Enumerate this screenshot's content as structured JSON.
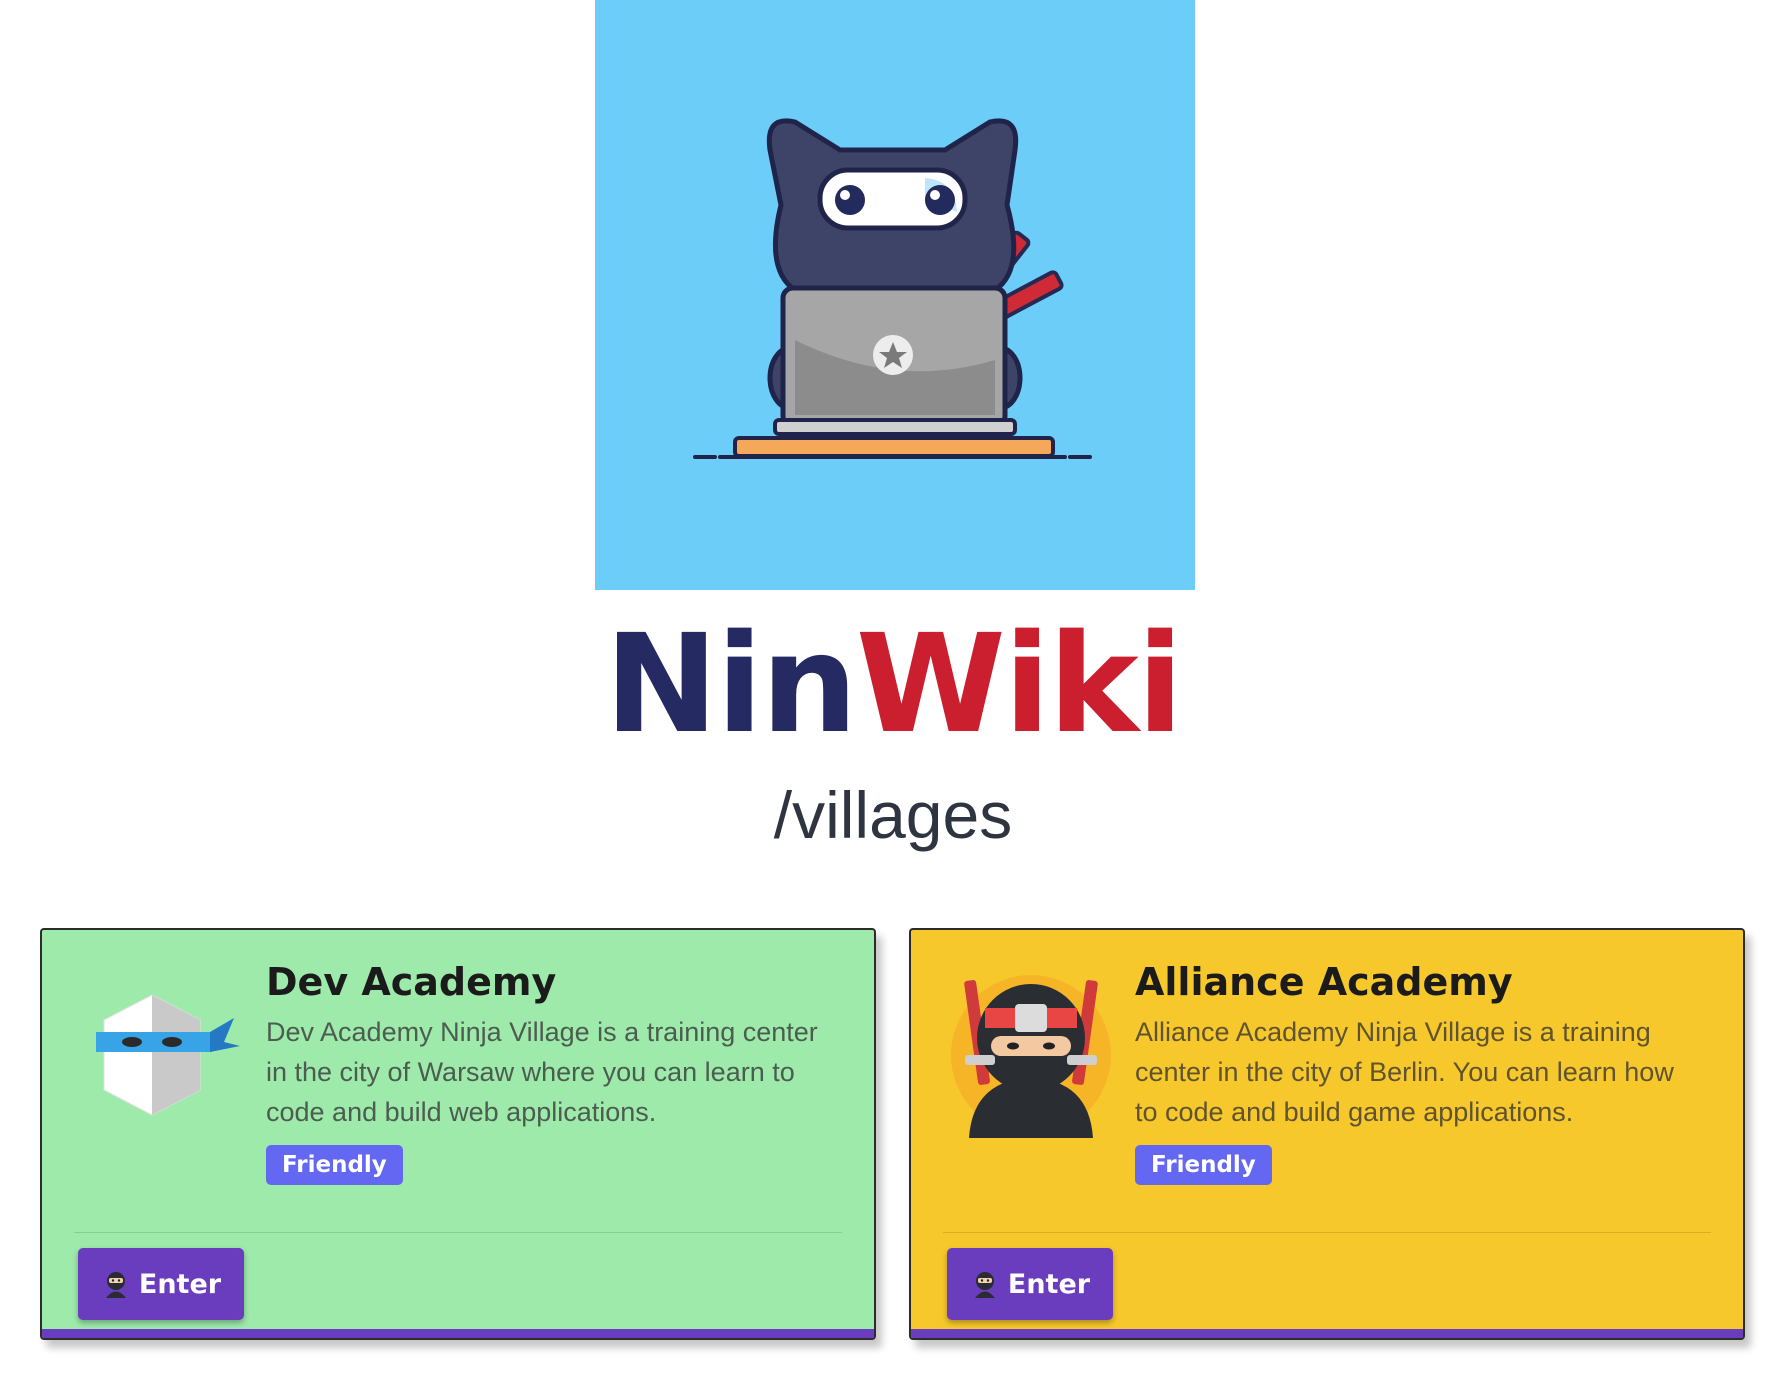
{
  "hero": {
    "image_icon": "ninja-cat-laptop-illustration"
  },
  "brand": {
    "part1": "Nin",
    "part2": "Wiki"
  },
  "page": {
    "subtitle": "/villages"
  },
  "villages": [
    {
      "name": "Dev Academy",
      "description": "Dev Academy Ninja Village is a training center in the city of Warsaw where you can learn to code and build web applications.",
      "badge": "Friendly",
      "button_label": "Enter",
      "button_icon": "ninja-emoji-icon",
      "avatar_icon": "white-ninja-head-icon",
      "background": "#9deaab"
    },
    {
      "name": "Alliance Academy",
      "description": "Alliance Academy Ninja Village is a training center in the city of Berlin. You can learn how to code and build game applications.",
      "badge": "Friendly",
      "button_label": "Enter",
      "button_icon": "ninja-emoji-icon",
      "avatar_icon": "ninja-with-swords-icon",
      "background": "#f7c82c"
    }
  ],
  "colors": {
    "brand_dark": "#252b62",
    "brand_red": "#cb1f2f",
    "button": "#6a3dbf",
    "badge": "#6467f2",
    "hero_bg": "#6bcdf8"
  }
}
